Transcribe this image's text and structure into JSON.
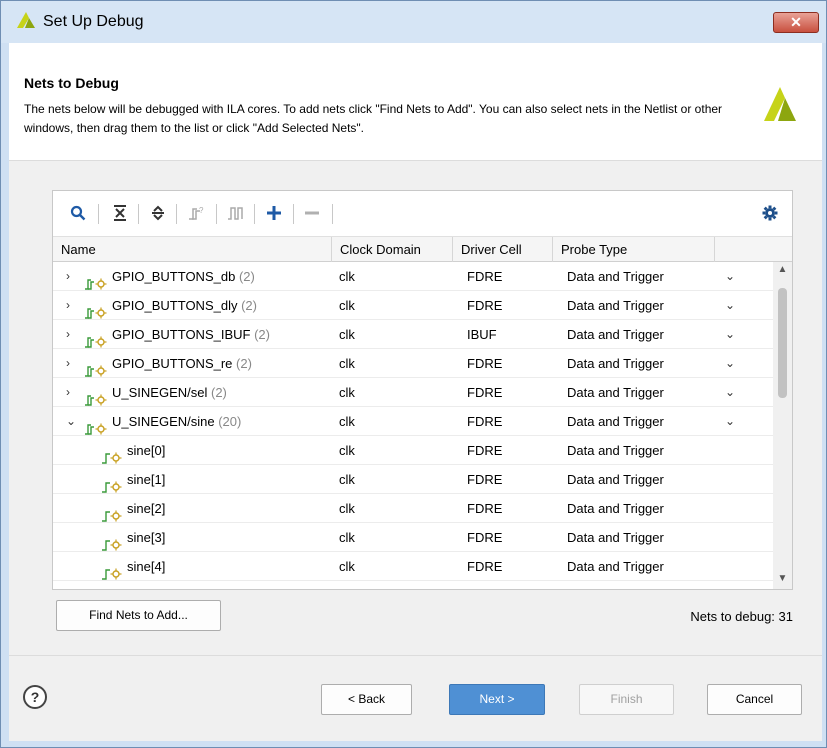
{
  "window": {
    "title": "Set Up Debug",
    "close_label": "✕"
  },
  "header": {
    "title": "Nets to Debug",
    "description": "The nets below will be debugged with ILA cores. To add nets click \"Find Nets to Add\". You can also select nets in the Netlist or other windows, then drag them to the list or click \"Add Selected Nets\"."
  },
  "toolbar": {
    "icons": [
      "search-icon",
      "collapse-all-icon",
      "expand-all-icon",
      "bus-icon",
      "signal-icon",
      "add-icon",
      "remove-icon",
      "settings-icon"
    ]
  },
  "table": {
    "columns": [
      "Name",
      "Clock Domain",
      "Driver Cell",
      "Probe Type"
    ],
    "rows": [
      {
        "expander": "›",
        "name": "GPIO_BUTTONS_db",
        "count": "(2)",
        "clock": "clk",
        "driver": "FDRE",
        "probe": "Data and Trigger",
        "has_dropdown": true
      },
      {
        "expander": "›",
        "name": "GPIO_BUTTONS_dly",
        "count": "(2)",
        "clock": "clk",
        "driver": "FDRE",
        "probe": "Data and Trigger",
        "has_dropdown": true
      },
      {
        "expander": "›",
        "name": "GPIO_BUTTONS_IBUF",
        "count": "(2)",
        "clock": "clk",
        "driver": "IBUF",
        "probe": "Data and Trigger",
        "has_dropdown": true
      },
      {
        "expander": "›",
        "name": "GPIO_BUTTONS_re",
        "count": "(2)",
        "clock": "clk",
        "driver": "FDRE",
        "probe": "Data and Trigger",
        "has_dropdown": true
      },
      {
        "expander": "›",
        "name": "U_SINEGEN/sel",
        "count": "(2)",
        "clock": "clk",
        "driver": "FDRE",
        "probe": "Data and Trigger",
        "has_dropdown": true
      },
      {
        "expander": "⌄",
        "name": "U_SINEGEN/sine",
        "count": "(20)",
        "clock": "clk",
        "driver": "FDRE",
        "probe": "Data and Trigger",
        "has_dropdown": true
      },
      {
        "expander": "",
        "name": "sine[0]",
        "count": "",
        "clock": "clk",
        "driver": "FDRE",
        "probe": "Data and Trigger",
        "has_dropdown": false
      },
      {
        "expander": "",
        "name": "sine[1]",
        "count": "",
        "clock": "clk",
        "driver": "FDRE",
        "probe": "Data and Trigger",
        "has_dropdown": false
      },
      {
        "expander": "",
        "name": "sine[2]",
        "count": "",
        "clock": "clk",
        "driver": "FDRE",
        "probe": "Data and Trigger",
        "has_dropdown": false
      },
      {
        "expander": "",
        "name": "sine[3]",
        "count": "",
        "clock": "clk",
        "driver": "FDRE",
        "probe": "Data and Trigger",
        "has_dropdown": false
      },
      {
        "expander": "",
        "name": "sine[4]",
        "count": "",
        "clock": "clk",
        "driver": "FDRE",
        "probe": "Data and Trigger",
        "has_dropdown": false
      }
    ],
    "dropdown_glyph": "⌄"
  },
  "actions": {
    "find_nets_label": "Find Nets to Add...",
    "nets_to_debug": "Nets to debug: 31"
  },
  "footer": {
    "help_label": "?",
    "back_label": "< Back",
    "next_label": "Next >",
    "finish_label": "Finish",
    "cancel_label": "Cancel"
  },
  "colors": {
    "accent": "#4f90d4",
    "logo": "#c6d318",
    "title_bar": "#d6e5f5"
  }
}
